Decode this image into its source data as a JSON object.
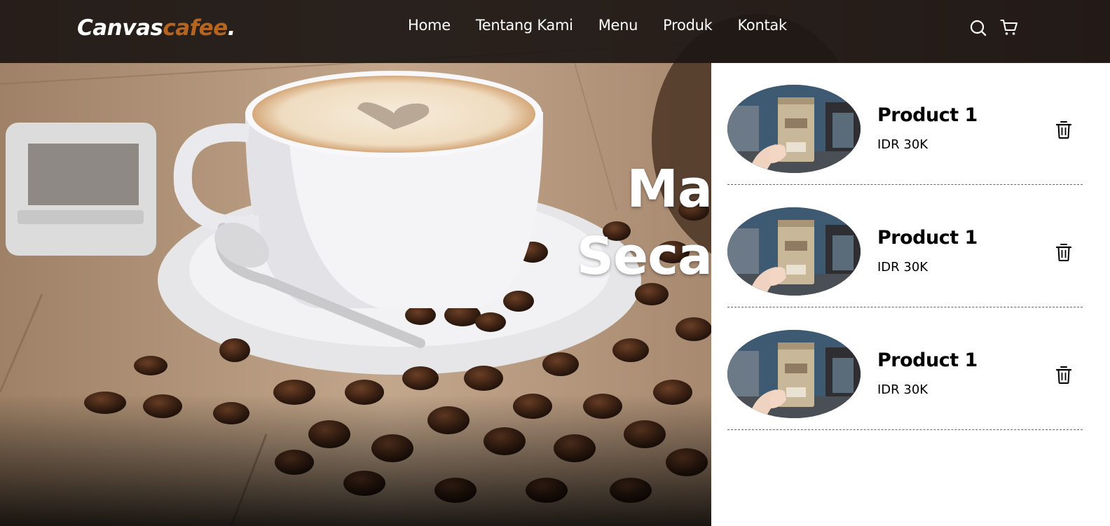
{
  "brand": {
    "part1": "Canvas",
    "part2": "cafee",
    "part3": "."
  },
  "nav": {
    "links": [
      "Home",
      "Tentang Kami",
      "Menu",
      "Produk",
      "Kontak"
    ],
    "icons": [
      "search-icon",
      "cart-icon"
    ]
  },
  "hero": {
    "headline_line1": "Ma",
    "headline_line2": "Seca"
  },
  "cart": {
    "items": [
      {
        "name": "Product 1",
        "price": "IDR 30K"
      },
      {
        "name": "Product 1",
        "price": "IDR 30K"
      },
      {
        "name": "Product 1",
        "price": "IDR 30K"
      }
    ],
    "remove_icon": "trash-icon"
  },
  "colors": {
    "accent": "#b6651f",
    "navbar": "#1c1613",
    "panel": "#ffffff"
  }
}
